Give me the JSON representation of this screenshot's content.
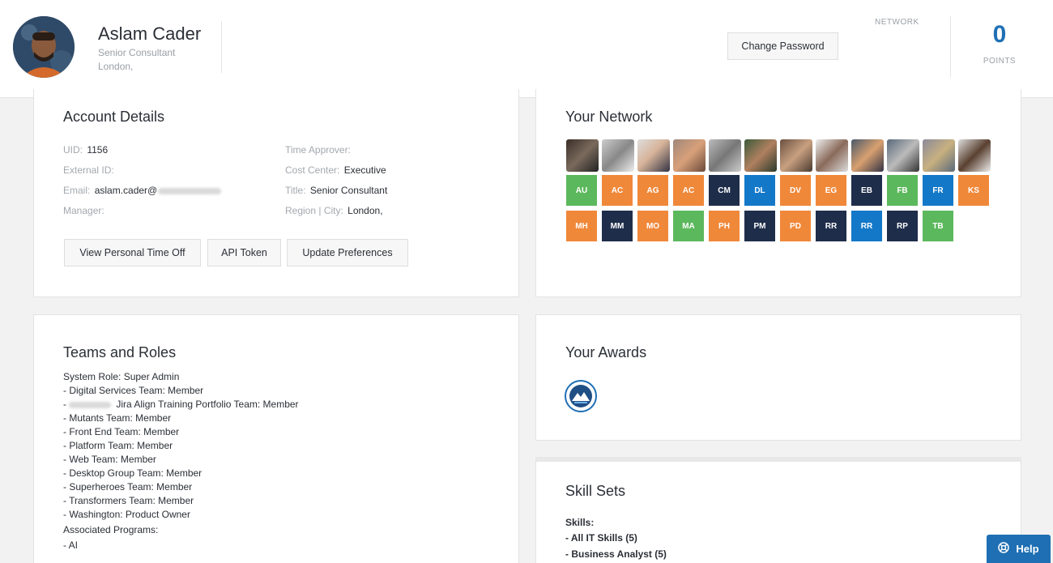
{
  "profile": {
    "name": "Aslam Cader",
    "title": "Senior Consultant",
    "location": "London,",
    "change_password": "Change Password",
    "network_label": "NETWORK",
    "points_value": "0",
    "points_label": "POINTS"
  },
  "account": {
    "title": "Account Details",
    "uid_label": "UID:",
    "uid_value": "1156",
    "external_id_label": "External ID:",
    "email_label": "Email:",
    "email_value": "aslam.cader@",
    "manager_label": "Manager:",
    "time_approver_label": "Time Approver:",
    "cost_center_label": "Cost Center:",
    "cost_center_value": "Executive",
    "title_label": "Title:",
    "title_value": "Senior Consultant",
    "region_label": "Region | City:",
    "region_value": "London,",
    "buttons": [
      "View Personal Time Off",
      "API Token",
      "Update Preferences"
    ]
  },
  "network": {
    "title": "Your Network",
    "members": [
      {
        "initials": "AU",
        "color": "#5cb85c"
      },
      {
        "initials": "AC",
        "color": "#f0883a"
      },
      {
        "initials": "AG",
        "color": "#f0883a"
      },
      {
        "initials": "AC",
        "color": "#f0883a"
      },
      {
        "initials": "CM",
        "color": "#1e2d4a"
      },
      {
        "initials": "DL",
        "color": "#1478c8"
      },
      {
        "initials": "DV",
        "color": "#f0883a"
      },
      {
        "initials": "EG",
        "color": "#f0883a"
      },
      {
        "initials": "EB",
        "color": "#1e2d4a"
      },
      {
        "initials": "FB",
        "color": "#5cb85c"
      },
      {
        "initials": "FR",
        "color": "#1478c8"
      },
      {
        "initials": "KS",
        "color": "#f0883a"
      },
      {
        "initials": "MH",
        "color": "#f0883a"
      },
      {
        "initials": "MM",
        "color": "#1e2d4a"
      },
      {
        "initials": "MO",
        "color": "#f0883a"
      },
      {
        "initials": "MA",
        "color": "#5cb85c"
      },
      {
        "initials": "PH",
        "color": "#f0883a"
      },
      {
        "initials": "PM",
        "color": "#1e2d4a"
      },
      {
        "initials": "PD",
        "color": "#f0883a"
      },
      {
        "initials": "RR",
        "color": "#1e2d4a"
      },
      {
        "initials": "RR",
        "color": "#1478c8"
      },
      {
        "initials": "RP",
        "color": "#1e2d4a"
      },
      {
        "initials": "TB",
        "color": "#5cb85c"
      }
    ]
  },
  "teams": {
    "title": "Teams and Roles",
    "system_role": "System Role: Super Admin",
    "items": [
      "- Digital Services Team: Member",
      "Jira Align Training Portfolio Team: Member",
      "- Mutants Team: Member",
      "- Front End Team: Member",
      "- Platform Team: Member",
      "- Web Team: Member",
      "- Desktop Group Team: Member",
      "- Superheroes Team: Member",
      "- Transformers Team: Member",
      "- Washington: Product Owner"
    ],
    "associated_label": "Associated Programs:",
    "programs": [
      "- AI"
    ]
  },
  "awards": {
    "title": "Your Awards"
  },
  "skills": {
    "title": "Skill Sets",
    "label": "Skills:",
    "items": [
      "- All IT Skills (5)",
      "- Business Analyst (5)"
    ]
  },
  "help": {
    "label": "Help"
  }
}
